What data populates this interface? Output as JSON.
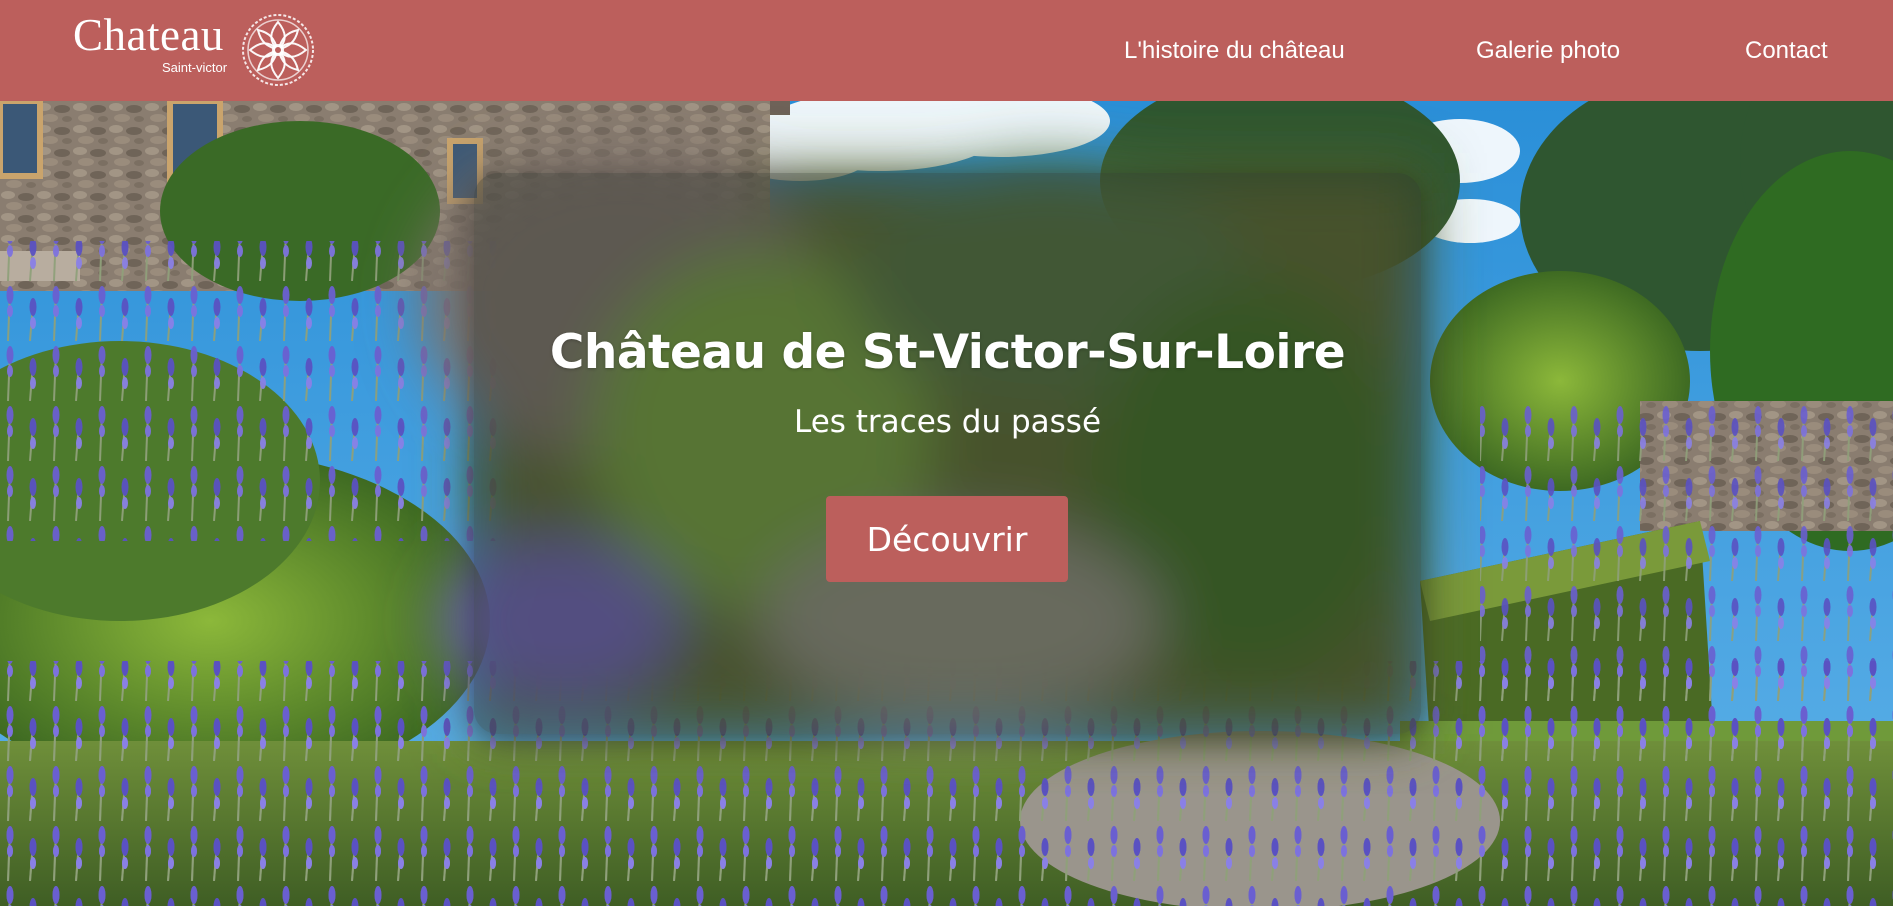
{
  "header": {
    "logo_title": "Chateau",
    "logo_subtitle": "Saint-victor",
    "logo_icon": "rose-emblem-icon",
    "nav": [
      {
        "label": "L'histoire du château"
      },
      {
        "label": "Galerie photo"
      },
      {
        "label": "Contact"
      }
    ],
    "bg_color": "#bc5f5c"
  },
  "hero": {
    "title": "Château de St-Victor-Sur-Loire",
    "subtitle": "Les traces du passé",
    "cta_label": "Découvrir",
    "cta_color": "#bc5f5c"
  }
}
